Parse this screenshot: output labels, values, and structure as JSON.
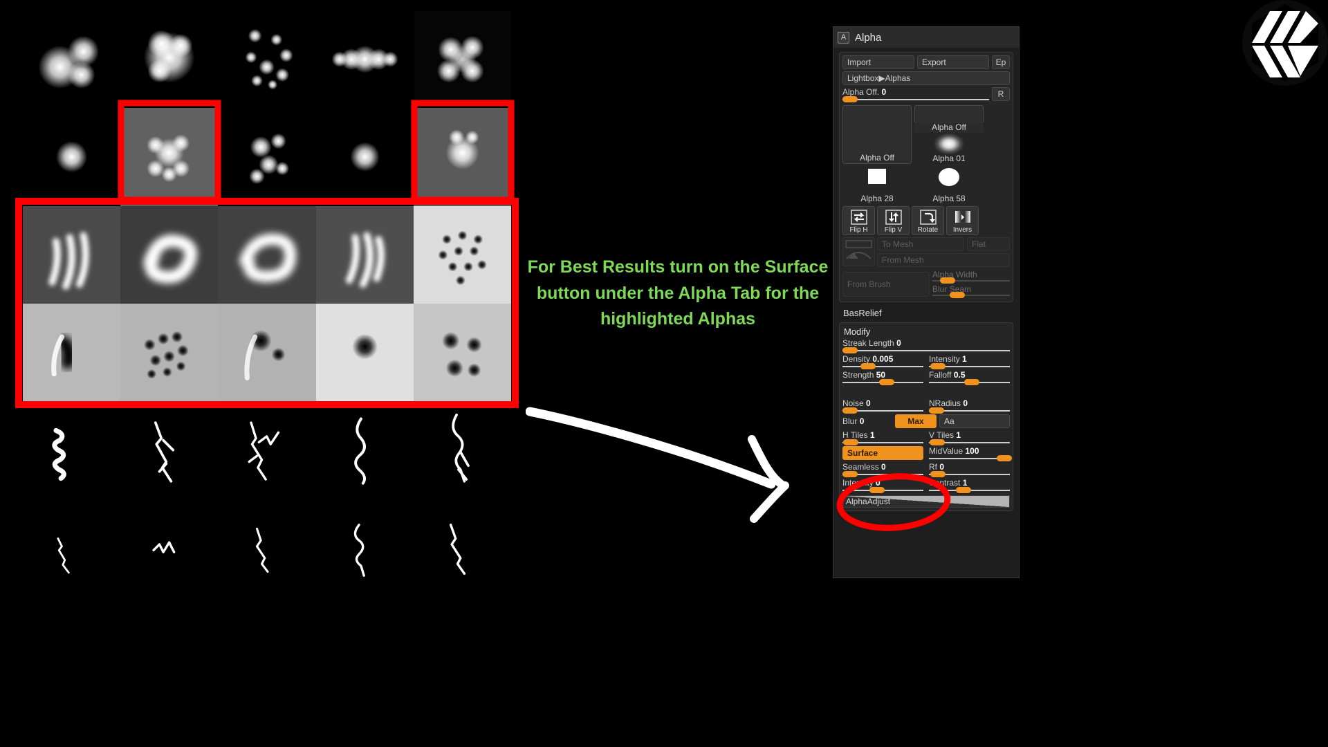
{
  "instruction": {
    "text": "For Best Results turn on the Surface button under the Alpha Tab for the highlighted Alphas",
    "color": "#7ed957"
  },
  "annotations": {
    "arrow_color": "#ffffff",
    "highlight_color": "#ff0000",
    "arrow_name": "pointer-arrow",
    "ellipse_name": "surface-button-circle"
  },
  "logo": {
    "name": "hexagon-logo"
  },
  "panel": {
    "title": "Alpha",
    "badge": "A",
    "top_buttons": {
      "import": "Import",
      "export": "Export",
      "ep": "Ep"
    },
    "lightbox": "Lightbox▶Alphas",
    "alpha_off_slider": {
      "label": "Alpha Off.",
      "value": "0",
      "reset": "R",
      "knob_pct": 2
    },
    "slots": [
      {
        "name": "Alpha Off",
        "art": "empty"
      },
      {
        "name": "Alpha Off",
        "art": "empty"
      },
      {
        "name": "Alpha 01",
        "art": "glow"
      },
      {
        "name": "Alpha 28",
        "art": "square"
      },
      {
        "name": "Alpha 58",
        "art": "circle"
      }
    ],
    "transform": [
      {
        "label": "Flip H",
        "icon": "flip-horizontal-icon"
      },
      {
        "label": "Flip V",
        "icon": "flip-vertical-icon"
      },
      {
        "label": "Rotate",
        "icon": "rotate-icon"
      },
      {
        "label": "Invers",
        "icon": "invert-icon"
      }
    ],
    "mesh": {
      "to_mesh": "To Mesh",
      "flat": "Flat",
      "from_mesh": "From Mesh",
      "from_brush": "From Brush"
    },
    "mesh_sliders": [
      {
        "label": "Alpha Width",
        "value": "",
        "knob_pct": 10
      },
      {
        "label": "Blur Seam",
        "value": "",
        "knob_pct": 22
      }
    ],
    "bas_relief": "BasRelief",
    "modify": "Modify",
    "sliders": [
      {
        "label": "Streak Length",
        "value": "0",
        "knob_pct": 1
      },
      {
        "label": "Density",
        "value": "0.005",
        "knob_pct": 26
      },
      {
        "label": "Intensity",
        "value": "1",
        "knob_pct": 6
      },
      {
        "label": "Strength",
        "value": "50",
        "knob_pct": 49
      },
      {
        "label": "Falloff",
        "value": "0.5",
        "knob_pct": 46
      },
      {
        "label": "Noise",
        "value": "0",
        "knob_pct": 1
      },
      {
        "label": "NRadius",
        "value": "0",
        "knob_pct": 1
      },
      {
        "label": "Blur",
        "value": "0",
        "knob_pct": 1
      },
      {
        "label": "H Tiles",
        "value": "1",
        "knob_pct": 2
      },
      {
        "label": "V Tiles",
        "value": "1",
        "knob_pct": 2
      },
      {
        "label": "MidValue",
        "value": "100",
        "knob_pct": 86
      },
      {
        "label": "Seamless",
        "value": "0",
        "knob_pct": 1
      },
      {
        "label": "Rf",
        "value": "0",
        "knob_pct": 4
      },
      {
        "label": "Intensity",
        "value": "0",
        "knob_pct": 36
      },
      {
        "label": "Contrast",
        "value": "1",
        "knob_pct": 36
      }
    ],
    "toggles": {
      "max": "Max",
      "aa": "Aa",
      "surface": "Surface"
    },
    "alpha_adjust": "AlphaAdjust"
  },
  "alpha_grid": {
    "rows": 6,
    "cols": 5,
    "cells": [
      {
        "art": "blob-trio",
        "bg": "#000000",
        "selected": false
      },
      {
        "art": "blob-fluffy",
        "bg": "#000000",
        "selected": false
      },
      {
        "art": "dots-scatter",
        "bg": "#000000",
        "selected": false
      },
      {
        "art": "blob-wide",
        "bg": "#000000",
        "selected": false
      },
      {
        "art": "blob-cluster",
        "bg": "#050505",
        "selected": false
      },
      {
        "art": "ring-single",
        "bg": "#000000",
        "selected": false
      },
      {
        "art": "bubble-mass",
        "bg": "#616161",
        "selected": true
      },
      {
        "art": "bubble-chain",
        "bg": "#000000",
        "selected": false
      },
      {
        "art": "ring-double",
        "bg": "#000000",
        "selected": false
      },
      {
        "art": "swirl-orb",
        "bg": "#5a5a5a",
        "selected": true
      },
      {
        "art": "squiggle-streak",
        "bg": "#4a4a4a",
        "selected": true
      },
      {
        "art": "cloud-knot",
        "bg": "#3c3c3c",
        "selected": true
      },
      {
        "art": "cloud-coil",
        "bg": "#414141",
        "selected": true
      },
      {
        "art": "flame-wisp",
        "bg": "#4e4e4e",
        "selected": true
      },
      {
        "art": "dot-lattice",
        "bg": "#dcdcdc",
        "selected": true
      },
      {
        "art": "dent-hook",
        "bg": "#b9b9b9",
        "selected": true
      },
      {
        "art": "dent-field",
        "bg": "#b4b4b4",
        "selected": true
      },
      {
        "art": "dent-comet",
        "bg": "#b2b2b2",
        "selected": true
      },
      {
        "art": "dent-oval",
        "bg": "#e0e0e0",
        "selected": true
      },
      {
        "art": "dent-quad",
        "bg": "#c6c6c6",
        "selected": true
      },
      {
        "art": "bolt-coil",
        "bg": "#000000",
        "selected": false
      },
      {
        "art": "bolt-branch",
        "bg": "#000000",
        "selected": false
      },
      {
        "art": "bolt-fork",
        "bg": "#000000",
        "selected": false
      },
      {
        "art": "bolt-wave",
        "bg": "#000000",
        "selected": false
      },
      {
        "art": "bolt-tall",
        "bg": "#000000",
        "selected": false
      },
      {
        "art": "bolt-thin-a",
        "bg": "#000000",
        "selected": false
      },
      {
        "art": "bolt-thin-b",
        "bg": "#000000",
        "selected": false
      },
      {
        "art": "bolt-thin-c",
        "bg": "#000000",
        "selected": false
      },
      {
        "art": "bolt-thin-d",
        "bg": "#000000",
        "selected": false
      },
      {
        "art": "bolt-thin-e",
        "bg": "#000000",
        "selected": false
      }
    ]
  }
}
